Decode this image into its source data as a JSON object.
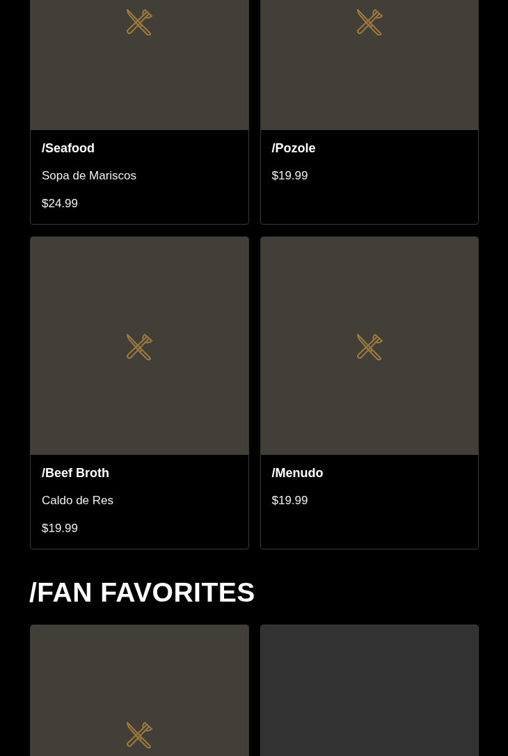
{
  "sections": [
    {
      "items": [
        {
          "title": "/Seafood",
          "subtitle": "Sopa de Mariscos",
          "price": "$24.99",
          "kind": "placeholder"
        },
        {
          "title": "/Pozole",
          "price": "$19.99",
          "kind": "placeholder"
        },
        {
          "title": "/Beef Broth",
          "subtitle": "Caldo de Res",
          "price": "$19.99",
          "kind": "placeholder"
        },
        {
          "title": "/Menudo",
          "price": "$19.99",
          "kind": "placeholder"
        }
      ]
    },
    {
      "heading": "/FAN FAVORITES",
      "items": [
        {
          "kind": "placeholder"
        },
        {
          "kind": "loading"
        }
      ]
    }
  ]
}
